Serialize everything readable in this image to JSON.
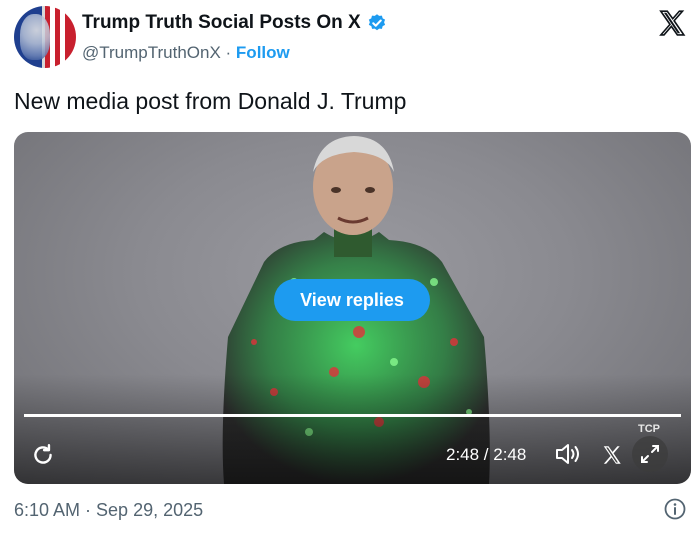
{
  "account": {
    "display_name": "Trump Truth Social Posts On X",
    "handle": "@TrumpTruthOnX",
    "separator": " · ",
    "follow_label": "Follow"
  },
  "post": {
    "text": "New media post from Donald J. Trump",
    "timestamp": "6:10 AM · Sep 29, 2025"
  },
  "video": {
    "overlay_button": "View replies",
    "time_display": "2:48 / 2:48",
    "watermark": "TCP",
    "progress_fraction": 1.0
  },
  "icons": {
    "verified": "verified-badge-icon",
    "platform": "x-logo-icon",
    "replay": "replay-icon",
    "volume": "volume-icon",
    "fullscreen": "fullscreen-icon",
    "info": "info-icon"
  },
  "colors": {
    "accent": "#1d9bf0",
    "secondary_text": "#536471",
    "primary_text": "#0f1419"
  }
}
